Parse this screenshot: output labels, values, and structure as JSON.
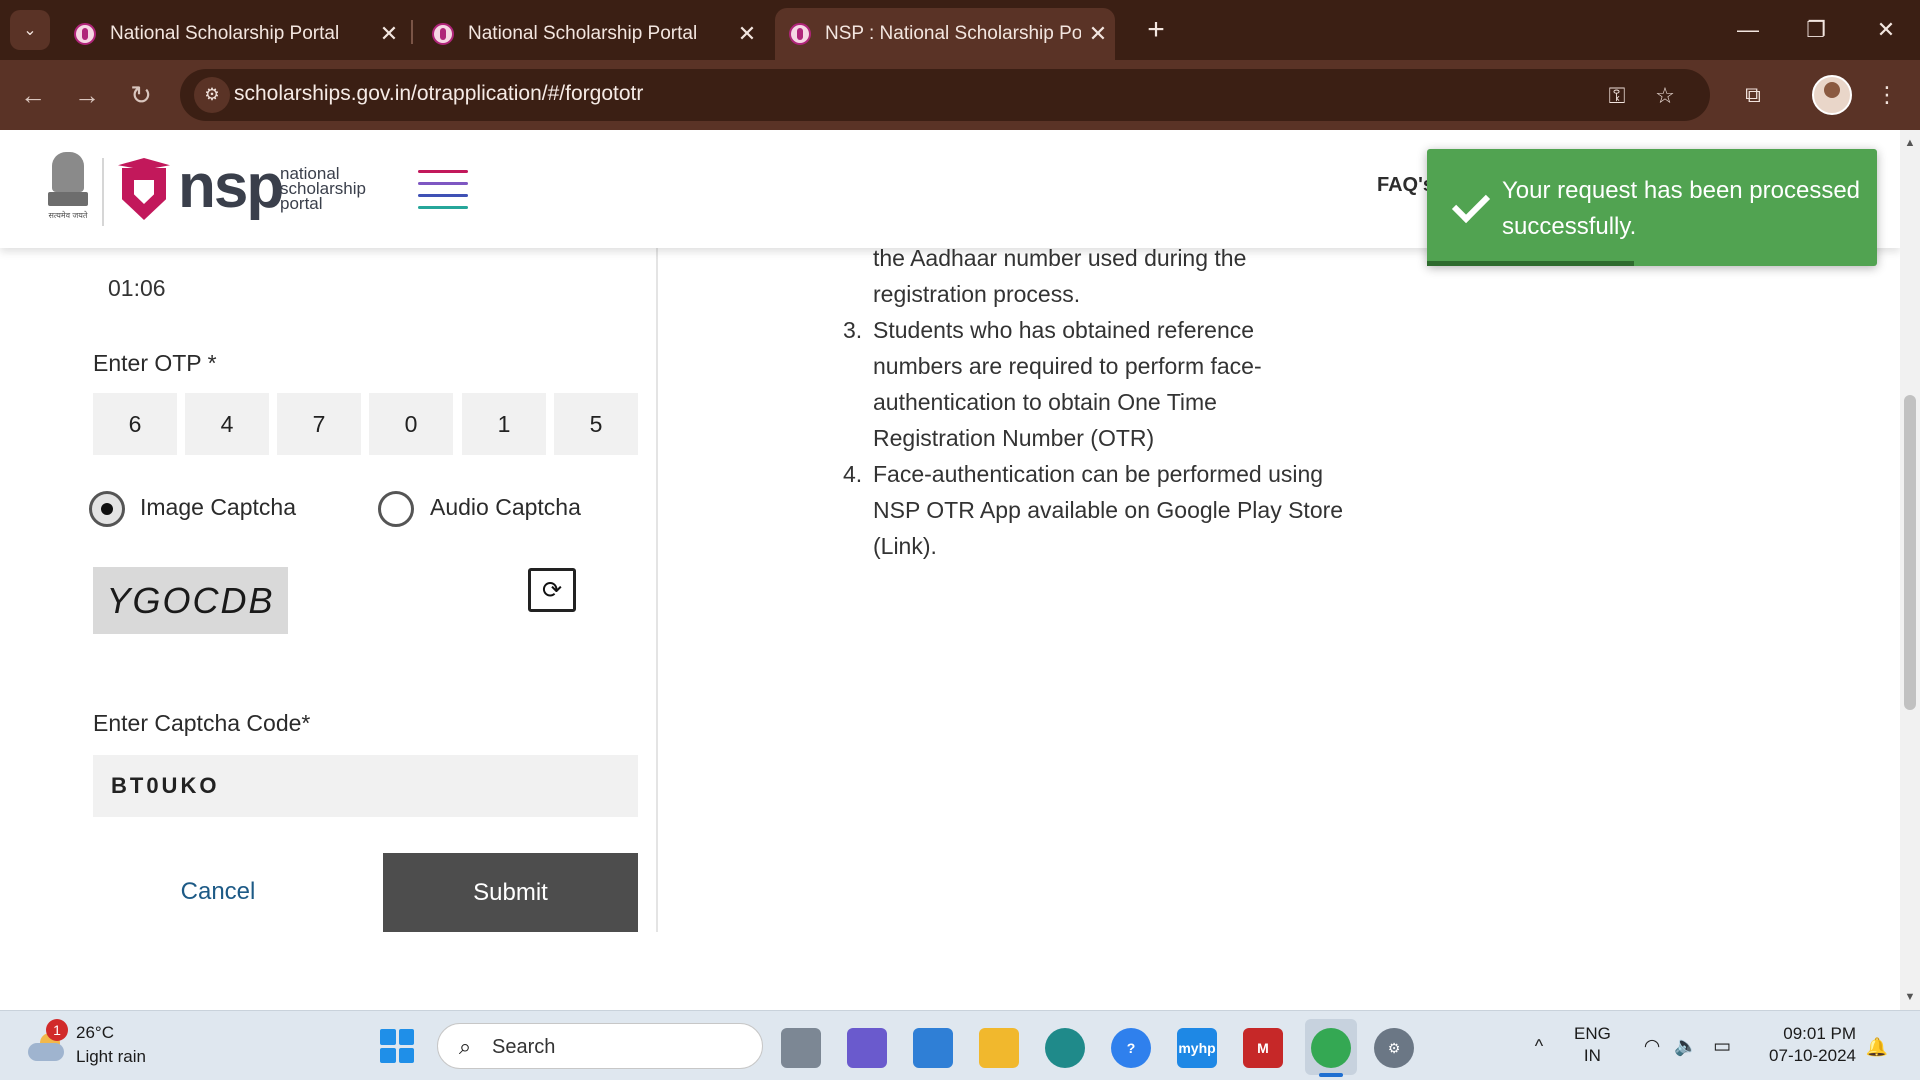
{
  "browser": {
    "tabs": [
      {
        "title": "National Scholarship Portal",
        "close": "✕"
      },
      {
        "title": "National Scholarship Portal",
        "close": "✕"
      },
      {
        "title": "NSP : National Scholarship Portal",
        "close": "✕"
      }
    ],
    "active_tab_index": 2,
    "new_tab": "+",
    "tab_menu": "⌄",
    "window": {
      "minimize": "—",
      "restore": "❐",
      "close": "✕"
    },
    "nav": {
      "back": "←",
      "forward": "→",
      "reload": "↻"
    },
    "url": "scholarships.gov.in/otrapplication/#/forgototr",
    "site_info_icon": "⚙",
    "omni_icons": {
      "password_key": "⚿",
      "bookmark_star": "☆",
      "extensions": "⧉",
      "menu": "⋮"
    }
  },
  "header": {
    "emblem_caption": "सत्यमेव जयते",
    "logo_word": "nsp",
    "logo_sub": [
      "national",
      "scholarship",
      "portal"
    ],
    "faq_label": "FAQ's",
    "hamburger_colors": [
      "#c2185b",
      "#7e57c2",
      "#3f51b5",
      "#26a69a"
    ]
  },
  "toast": {
    "message": "Your request has been processed successfully.",
    "color": "#51a351"
  },
  "form": {
    "timer": "01:06",
    "otp_label": "Enter OTP *",
    "otp_digits": [
      "6",
      "4",
      "7",
      "0",
      "1",
      "5"
    ],
    "captcha_options": [
      {
        "label": "Image Captcha",
        "checked": true
      },
      {
        "label": "Audio Captcha",
        "checked": false
      }
    ],
    "captcha_image_text": "YGOCDB",
    "refresh_icon": "⟳",
    "captcha_code_label": "Enter Captcha Code*",
    "captcha_code_value": "BT0UKO",
    "cancel_label": "Cancel",
    "submit_label": "Submit"
  },
  "instructions": {
    "items": [
      {
        "num": "",
        "lines": [
          "the Aadhaar number used during the",
          "registration process."
        ]
      },
      {
        "num": "3.",
        "lines": [
          "Students who has obtained reference",
          "numbers are required to perform face-",
          "authentication to obtain One Time",
          "Registration Number (OTR)"
        ]
      },
      {
        "num": "4.",
        "lines": [
          "Face-authentication can be performed using",
          "NSP OTR App available on Google Play Store",
          "(Link)."
        ]
      }
    ]
  },
  "taskbar": {
    "weather": {
      "temp": "26°C",
      "desc": "Light rain",
      "badge": "1"
    },
    "search_placeholder": "Search",
    "search_icon": "⌕",
    "apps": [
      {
        "name": "task-view",
        "color": "#7c8794",
        "label": ""
      },
      {
        "name": "copilot",
        "color": "#6a5acd",
        "label": ""
      },
      {
        "name": "microsoft-store",
        "color": "#2f7fd6",
        "label": ""
      },
      {
        "name": "file-explorer",
        "color": "#f1b82d",
        "label": ""
      },
      {
        "name": "edge",
        "color": "#1f8a8a",
        "label": ""
      },
      {
        "name": "get-help",
        "color": "#2f80ed",
        "label": "?"
      },
      {
        "name": "myhp",
        "color": "#1e88e5",
        "label": "myhp"
      },
      {
        "name": "mcafee",
        "color": "#c62828",
        "label": "M"
      },
      {
        "name": "chrome",
        "color": "#34a853",
        "label": ""
      },
      {
        "name": "settings",
        "color": "#6b7785",
        "label": "⚙"
      }
    ],
    "tray": {
      "chevron": "^",
      "lang_top": "ENG",
      "lang_bottom": "IN",
      "wifi_icon": "◠",
      "volume_icon": "🔈",
      "battery_icon": "▭",
      "time": "09:01 PM",
      "date": "07-10-2024",
      "bell_icon": "🔔"
    }
  }
}
